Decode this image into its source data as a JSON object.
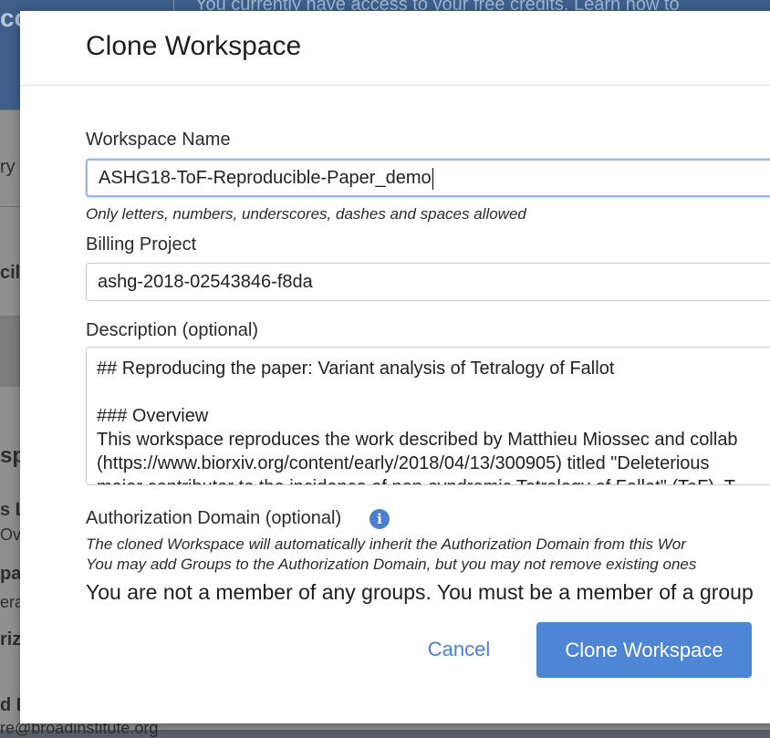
{
  "background": {
    "logo_fragment": "co",
    "banner_text": "You currently have access to your free credits. Learn how to",
    "sidebar_fragments": [
      "ry",
      "cil",
      "sp",
      "s L",
      "Ov",
      "pa",
      "era",
      "riza",
      "d I",
      "re@broadinstitute.org"
    ]
  },
  "modal": {
    "title": "Clone Workspace",
    "workspace_name": {
      "label": "Workspace Name",
      "value": "ASHG18-ToF-Reproducible-Paper_demo",
      "hint": "Only letters, numbers, underscores, dashes and spaces allowed"
    },
    "billing_project": {
      "label": "Billing Project",
      "value": "ashg-2018-02543846-f8da"
    },
    "description": {
      "label": "Description (optional)",
      "lines": [
        "## Reproducing the paper: Variant analysis of Tetralogy of Fallot",
        "",
        "### Overview",
        "This workspace reproduces the work described by Matthieu Miossec and collab",
        "(https://www.biorxiv.org/content/early/2018/04/13/300905) titled \"Deleterious",
        "major contributor to the incidence of non-syndromic Tetralogy of Fallot\" (ToF). T"
      ]
    },
    "authorization_domain": {
      "label": "Authorization Domain (optional)",
      "info_icon": "info-icon",
      "hint_line1": "The cloned Workspace will automatically inherit the Authorization Domain from this Wor",
      "hint_line2": "You may add Groups to the Authorization Domain, but you may not remove existing ones",
      "message": "You are not a member of any groups. You must be a member of a group"
    },
    "buttons": {
      "cancel": "Cancel",
      "submit": "Clone Workspace"
    }
  }
}
